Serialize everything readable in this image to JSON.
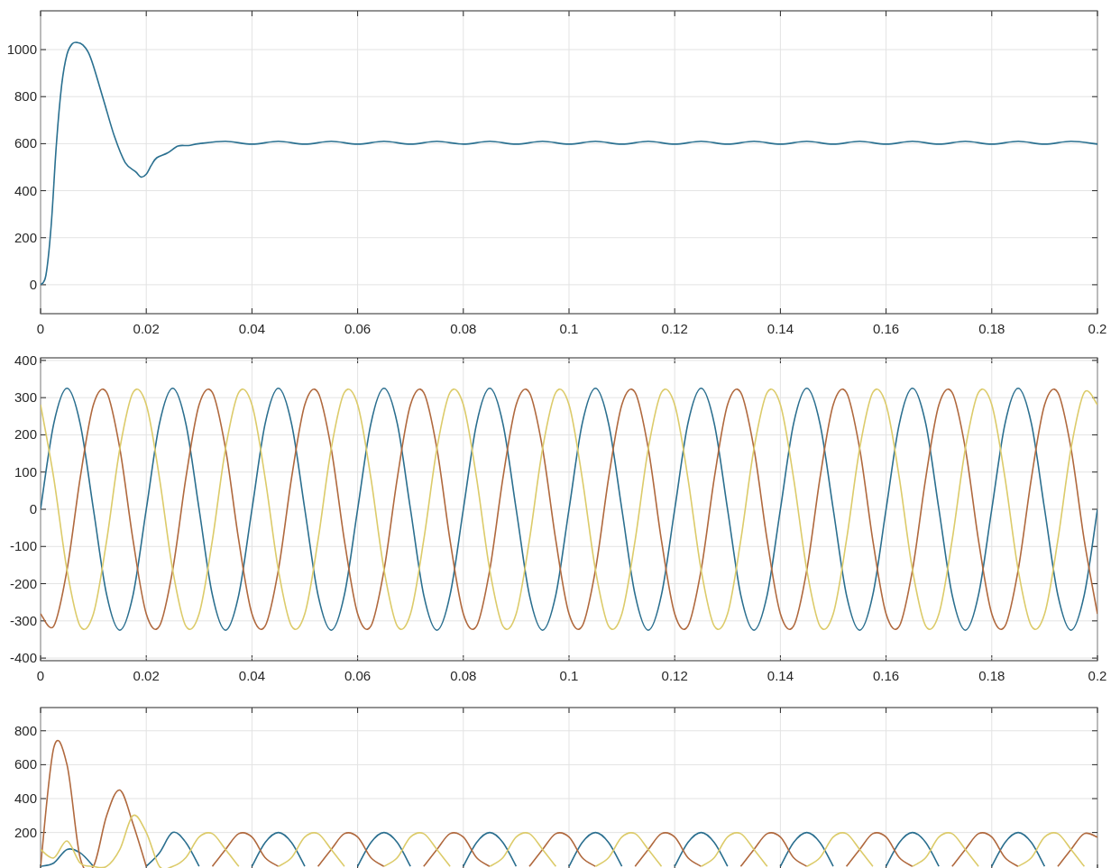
{
  "charts": [
    {
      "chart_data": {
        "type": "line",
        "grid": true,
        "xlim": [
          0,
          0.2
        ],
        "ylim": [
          -123,
          1165
        ],
        "xticks": [
          0,
          0.02,
          0.04,
          0.06,
          0.08,
          0.1,
          0.12,
          0.14,
          0.16,
          0.18,
          0.2
        ],
        "yticks": [
          0,
          200,
          400,
          600,
          800,
          1000
        ],
        "x": [
          0,
          0.001,
          0.002,
          0.003,
          0.004,
          0.005,
          0.006,
          0.007,
          0.008,
          0.009,
          0.01,
          0.012,
          0.014,
          0.016,
          0.018,
          0.019,
          0.02,
          0.021,
          0.022,
          0.024,
          0.026,
          0.028,
          0.03,
          0.035,
          0.04,
          0.045,
          0.05,
          0.055,
          0.06,
          0.065,
          0.07,
          0.075,
          0.08,
          0.085,
          0.09,
          0.095,
          0.1,
          0.105,
          0.11,
          0.115,
          0.12,
          0.125,
          0.13,
          0.135,
          0.14,
          0.145,
          0.15,
          0.155,
          0.16,
          0.165,
          0.17,
          0.175,
          0.18,
          0.185,
          0.19,
          0.195,
          0.2
        ],
        "series": [
          {
            "color": "#2a7090",
            "values": [
              0,
              40,
              250,
              600,
              850,
              980,
              1025,
              1030,
              1020,
              990,
              930,
              780,
              630,
              520,
              480,
              458,
              470,
              510,
              540,
              560,
              590,
              592,
              600,
              610,
              598,
              610,
              598,
              610,
              598,
              610,
              598,
              610,
              598,
              610,
              598,
              610,
              598,
              610,
              598,
              610,
              598,
              610,
              598,
              610,
              598,
              610,
              598,
              610,
              598,
              610,
              598,
              610,
              598,
              610,
              598,
              610,
              598
            ]
          }
        ]
      }
    },
    {
      "chart_data": {
        "type": "line",
        "grid": true,
        "xlim": [
          0,
          0.2
        ],
        "ylim": [
          -407,
          407
        ],
        "xticks": [
          0,
          0.02,
          0.04,
          0.06,
          0.08,
          0.1,
          0.12,
          0.14,
          0.16,
          0.18,
          0.2
        ],
        "yticks": [
          -400,
          -300,
          -200,
          -100,
          0,
          100,
          200,
          300,
          400
        ],
        "x": [
          0,
          0.0025,
          0.005,
          0.0075,
          0.01,
          0.0125,
          0.015,
          0.0175,
          0.02,
          0.0225,
          0.025,
          0.0275,
          0.03,
          0.0325,
          0.035,
          0.0375,
          0.04,
          0.0425,
          0.045,
          0.0475,
          0.05,
          0.0525,
          0.055,
          0.0575,
          0.06,
          0.0625,
          0.065,
          0.0675,
          0.07,
          0.0725,
          0.075,
          0.0775,
          0.08,
          0.0825,
          0.085,
          0.0875,
          0.09,
          0.0925,
          0.095,
          0.0975,
          0.1,
          0.1025,
          0.105,
          0.1075,
          0.11,
          0.1125,
          0.115,
          0.1175,
          0.12,
          0.1225,
          0.125,
          0.1275,
          0.13,
          0.1325,
          0.135,
          0.1375,
          0.14,
          0.1425,
          0.145,
          0.1475,
          0.15,
          0.1525,
          0.155,
          0.1575,
          0.16,
          0.1625,
          0.165,
          0.1675,
          0.17,
          0.1725,
          0.175,
          0.1775,
          0.18,
          0.1825,
          0.185,
          0.1875,
          0.19,
          0.1925,
          0.195,
          0.1975,
          0.2
        ],
        "series": [
          {
            "color": "#2b6f8f",
            "values": [
              0,
              230,
              325,
              230,
              0,
              -230,
              -325,
              -230,
              0,
              230,
              325,
              230,
              0,
              -230,
              -325,
              -230,
              0,
              230,
              325,
              230,
              0,
              -230,
              -325,
              -230,
              0,
              230,
              325,
              230,
              0,
              -230,
              -325,
              -230,
              0,
              230,
              325,
              230,
              0,
              -230,
              -325,
              -230,
              0,
              230,
              325,
              230,
              0,
              -230,
              -325,
              -230,
              0,
              230,
              325,
              230,
              0,
              -230,
              -325,
              -230,
              0,
              230,
              325,
              230,
              0,
              -230,
              -325,
              -230,
              0,
              230,
              325,
              230,
              0,
              -230,
              -325,
              -230,
              0,
              230,
              325,
              230,
              0,
              -230,
              -325,
              -230,
              0
            ]
          },
          {
            "color": "#b0693e",
            "values": [
              -281,
              -314,
              -163,
              84,
              281,
              314,
              163,
              -84,
              -281,
              -314,
              -163,
              84,
              281,
              314,
              163,
              -84,
              -281,
              -314,
              -163,
              84,
              281,
              314,
              163,
              -84,
              -281,
              -314,
              -163,
              84,
              281,
              314,
              163,
              -84,
              -281,
              -314,
              -163,
              84,
              281,
              314,
              163,
              -84,
              -281,
              -314,
              -163,
              84,
              281,
              314,
              163,
              -84,
              -281,
              -314,
              -163,
              84,
              281,
              314,
              163,
              -84,
              -281,
              -314,
              -163,
              84,
              281,
              314,
              163,
              -84,
              -281,
              -314,
              -163,
              84,
              281,
              314,
              163,
              -84,
              -281,
              -314,
              -163,
              84,
              281,
              314,
              163,
              -84,
              -281
            ]
          },
          {
            "color": "#dccb6a",
            "values": [
              281,
              84,
              -163,
              -314,
              -281,
              -84,
              163,
              314,
              281,
              84,
              -163,
              -314,
              -281,
              -84,
              163,
              314,
              281,
              84,
              -163,
              -314,
              -281,
              -84,
              163,
              314,
              281,
              84,
              -163,
              -314,
              -281,
              -84,
              163,
              314,
              281,
              84,
              -163,
              -314,
              -281,
              -84,
              163,
              314,
              281,
              84,
              -163,
              -314,
              -281,
              -84,
              163,
              314,
              281,
              84,
              -163,
              -314,
              -281,
              -84,
              163,
              314,
              281,
              84,
              -163,
              -314,
              -281,
              -84,
              163,
              314,
              281,
              84,
              -163,
              -314,
              -281,
              -84,
              163,
              314,
              281,
              84,
              -163,
              -314,
              -281,
              -84,
              163,
              314,
              281
            ]
          }
        ]
      }
    },
    {
      "chart_data": {
        "type": "line",
        "grid": true,
        "xlim": [
          0,
          0.2
        ],
        "ylim": [
          -20,
          937
        ],
        "yticks": [
          200,
          400,
          600,
          800
        ],
        "x": [
          0,
          0.0025,
          0.005,
          0.0075,
          0.01,
          0.0125,
          0.015,
          0.0175,
          0.02,
          0.0225,
          0.025,
          0.0275,
          0.03,
          0.0325,
          0.035,
          0.0375,
          0.04,
          0.0425,
          0.045,
          0.0475,
          0.05,
          0.0525,
          0.055,
          0.0575,
          0.06,
          0.0625,
          0.065,
          0.0675,
          0.07,
          0.0725,
          0.075,
          0.0775,
          0.08,
          0.0825,
          0.085,
          0.0875,
          0.09,
          0.0925,
          0.095,
          0.0975,
          0.1,
          0.1025,
          0.105,
          0.1075,
          0.11,
          0.1125,
          0.115,
          0.1175,
          0.12,
          0.1225,
          0.125,
          0.1275,
          0.13,
          0.1325,
          0.135,
          0.1375,
          0.14,
          0.1425,
          0.145,
          0.1475,
          0.15,
          0.1525,
          0.155,
          0.1575,
          0.16,
          0.1625,
          0.165,
          0.1675,
          0.17,
          0.1725,
          0.175,
          0.1775,
          0.18,
          0.1825,
          0.185,
          0.1875,
          0.19,
          0.1925,
          0.195,
          0.1975,
          0.2
        ],
        "series": [
          {
            "color": "#2b6f8f",
            "values": [
              0,
              20,
              100,
              80,
              0,
              null,
              null,
              null,
              0,
              80,
              200,
              141,
              0,
              null,
              null,
              null,
              0,
              141,
              200,
              141,
              0,
              null,
              null,
              null,
              0,
              141,
              200,
              141,
              0,
              null,
              null,
              null,
              0,
              141,
              200,
              141,
              0,
              null,
              null,
              null,
              0,
              141,
              200,
              141,
              0,
              null,
              null,
              null,
              0,
              141,
              200,
              141,
              0,
              null,
              null,
              null,
              0,
              141,
              200,
              141,
              0,
              null,
              null,
              null,
              0,
              141,
              200,
              141,
              0,
              null,
              null,
              null,
              0,
              141,
              200,
              141,
              0,
              null,
              null,
              null,
              null
            ]
          },
          {
            "color": "#b0693e",
            "values": [
              0,
              700,
              600,
              50,
              0,
              300,
              450,
              250,
              0,
              null,
              null,
              null,
              null,
              0,
              100,
              193,
              173,
              52,
              0,
              null,
              null,
              0,
              100,
              193,
              173,
              52,
              0,
              null,
              null,
              0,
              100,
              193,
              173,
              52,
              0,
              null,
              null,
              0,
              100,
              193,
              173,
              52,
              0,
              null,
              null,
              0,
              100,
              193,
              173,
              52,
              0,
              null,
              null,
              0,
              100,
              193,
              173,
              52,
              0,
              null,
              null,
              0,
              100,
              193,
              173,
              52,
              0,
              null,
              null,
              0,
              100,
              193,
              173,
              52,
              0,
              null,
              null,
              0,
              100,
              193,
              173
            ]
          },
          {
            "color": "#dccb6a",
            "values": [
              100,
              50,
              150,
              20,
              0,
              0,
              100,
              300,
              200,
              0,
              0,
              52,
              173,
              193,
              100,
              0,
              null,
              null,
              0,
              52,
              173,
              193,
              100,
              0,
              null,
              null,
              0,
              52,
              173,
              193,
              100,
              0,
              null,
              null,
              0,
              52,
              173,
              193,
              100,
              0,
              null,
              null,
              0,
              52,
              173,
              193,
              100,
              0,
              null,
              null,
              0,
              52,
              173,
              193,
              100,
              0,
              null,
              null,
              0,
              52,
              173,
              193,
              100,
              0,
              null,
              null,
              0,
              52,
              173,
              193,
              100,
              0,
              null,
              null,
              0,
              52,
              173,
              193,
              100,
              0,
              null
            ]
          }
        ]
      }
    }
  ]
}
